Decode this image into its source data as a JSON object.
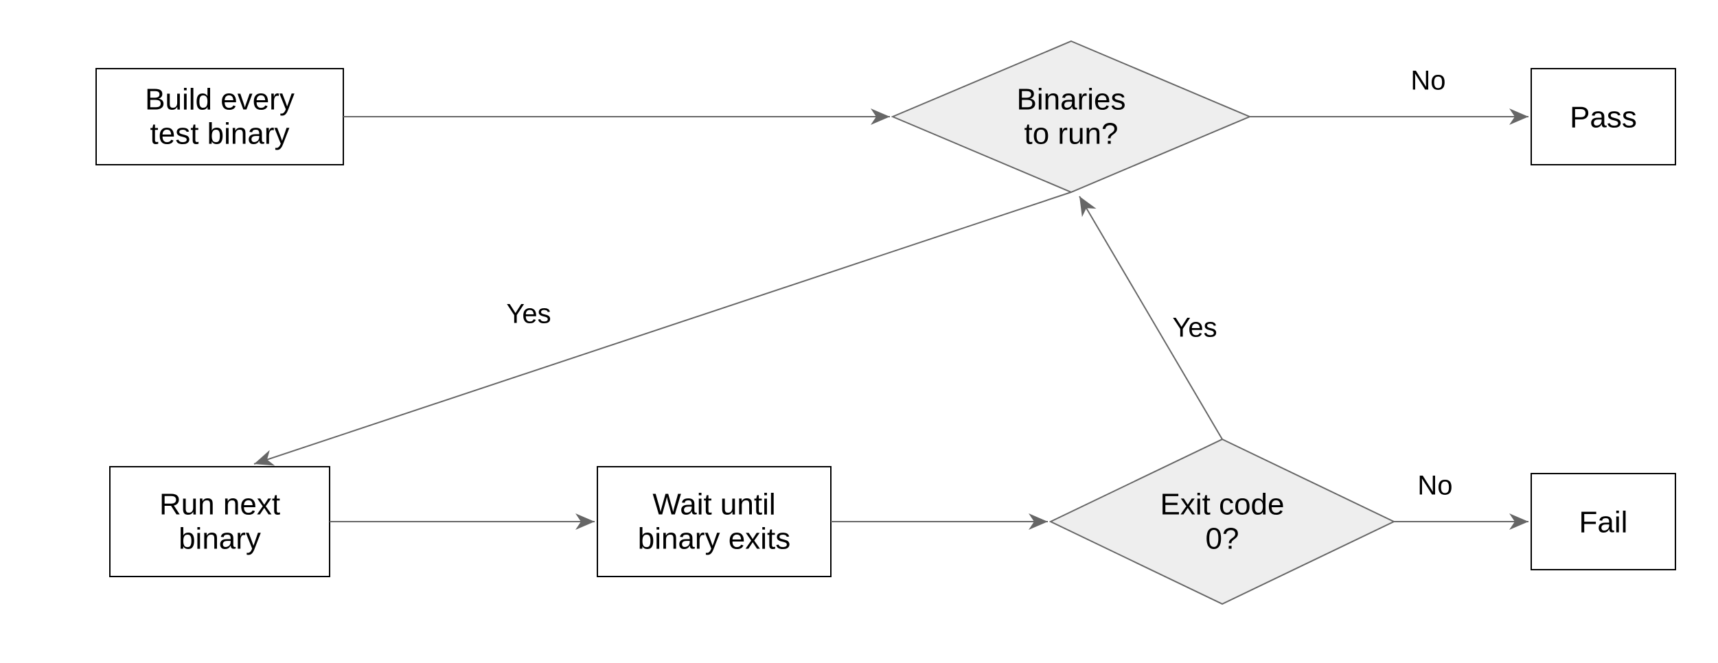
{
  "nodes": {
    "build": {
      "line1": "Build every",
      "line2": "test binary"
    },
    "check": {
      "line1": "Binaries",
      "line2": "to run?"
    },
    "pass": {
      "label": "Pass"
    },
    "run": {
      "line1": "Run next",
      "line2": "binary"
    },
    "wait": {
      "line1": "Wait until",
      "line2": "binary exits"
    },
    "exit": {
      "line1": "Exit code",
      "line2": "0?"
    },
    "fail": {
      "label": "Fail"
    }
  },
  "edges": {
    "check_no": "No",
    "check_yes": "Yes",
    "exit_no": "No",
    "exit_yes": "Yes"
  }
}
